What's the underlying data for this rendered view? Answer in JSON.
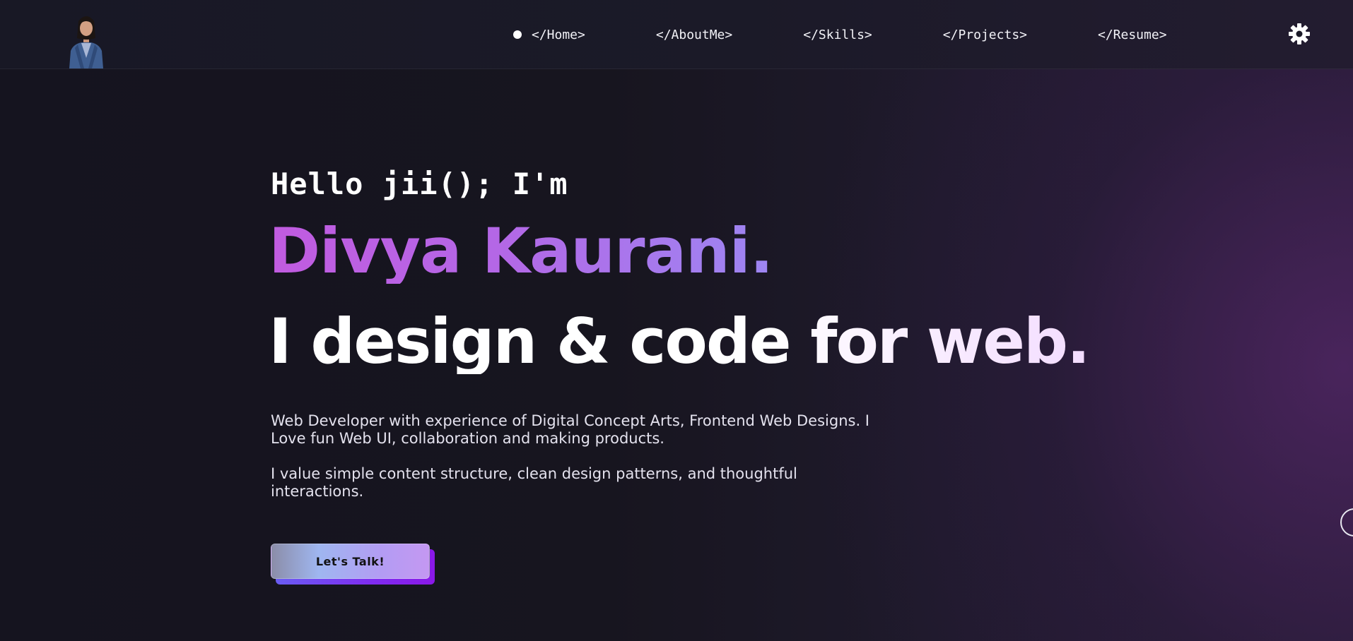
{
  "nav": {
    "items": [
      {
        "label": "</Home>",
        "active": true
      },
      {
        "label": "</AboutMe>",
        "active": false
      },
      {
        "label": "</Skills>",
        "active": false
      },
      {
        "label": "</Projects>",
        "active": false
      },
      {
        "label": "</Resume>",
        "active": false
      }
    ],
    "settings_icon": "gear-icon"
  },
  "hero": {
    "greeting": "Hello jii(); I'm",
    "name": "Divya Kaurani.",
    "tagline": "I design & code for web.",
    "description_1": "Web Developer with experience of Digital Concept Arts, Frontend Web Designs. I Love fun Web UI, collaboration and making products.",
    "description_2": "I value simple content structure, clean design patterns, and thoughtful interactions.",
    "cta_label": "Let's Talk!"
  },
  "colors": {
    "background": "#15141f",
    "accent_purple": "#b467e6",
    "accent_violet": "#7f2cf0",
    "text": "#ffffff"
  }
}
